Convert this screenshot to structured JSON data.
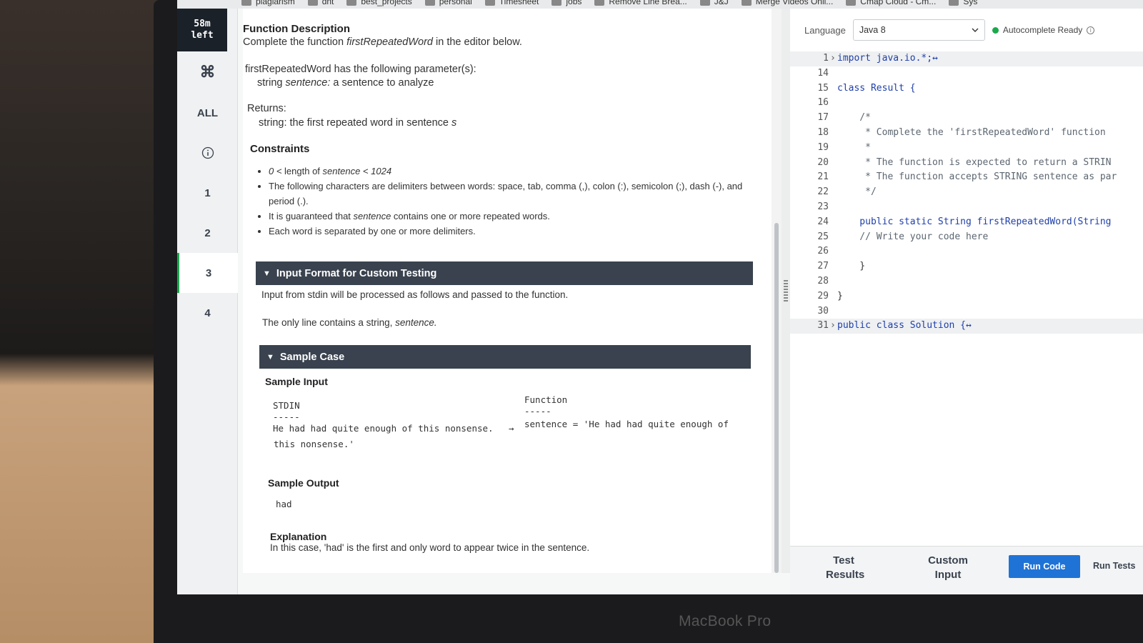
{
  "device_label": "MacBook Pro",
  "bookmarks": [
    "plagiarism",
    "dnt",
    "best_projects",
    "personal",
    "Timesheet",
    "jobs",
    "Remove Line Brea...",
    "J&J",
    "Merge Videos Onli...",
    "Cmap Cloud - Cm...",
    "Sys"
  ],
  "nav": {
    "timer": "58m left",
    "all": "ALL",
    "questions": [
      "1",
      "2",
      "3",
      "4"
    ],
    "active_question": "3"
  },
  "problem": {
    "function_description_title": "Function Description",
    "function_description_pre": "Complete the function ",
    "function_name": "firstRepeatedWord",
    "function_description_post": " in the editor below.",
    "params_title": "firstRepeatedWord has the following parameter(s):",
    "param_type": "string ",
    "param_name": "sentence:",
    "param_desc": " a sentence to analyze",
    "returns_title": "Returns:",
    "returns_desc": "string: the first repeated word in sentence ",
    "returns_var": "s",
    "constraints_title": "Constraints",
    "constraints": {
      "c1_pre": "0 < ",
      "c1_mid": "length of ",
      "c1_var": "sentence < 1024",
      "c2": "The following characters are delimiters between words: space, tab, comma (,), colon (:), semicolon (;), dash (-), and period (.).",
      "c3_pre": "It is guaranteed that ",
      "c3_var": "sentence",
      "c3_post": " contains one or more repeated words.",
      "c4": "Each word is separated by one or more delimiters."
    },
    "input_format_header": "Input Format for Custom Testing",
    "input_format_line1": "Input from stdin will be processed as follows and passed to the function.",
    "input_format_line2_pre": "The only line contains a string, ",
    "input_format_line2_var": "sentence.",
    "sample_case_header": "Sample Case",
    "sample_input_title": "Sample Input",
    "stdin_label": "STDIN",
    "function_label": "Function",
    "dashes": "-----",
    "stdin_value": "He had had quite enough of this nonsense.",
    "arrow": "→",
    "function_value": "sentence = 'He had had quite enough of",
    "function_value_cont": "this nonsense.'",
    "sample_output_title": "Sample Output",
    "sample_output": "had",
    "explanation_title": "Explanation",
    "explanation_text": "In this case, 'had' is the first and only word to appear twice in the sentence."
  },
  "editor": {
    "language_label": "Language",
    "language_value": "Java 8",
    "autocomplete_status": "Autocomplete Ready",
    "lines": [
      {
        "n": "1",
        "text": "import java.io.*;↔",
        "fold": true,
        "kind": "kw-import"
      },
      {
        "n": "14",
        "text": ""
      },
      {
        "n": "15",
        "text": "class Result {",
        "kind": "class"
      },
      {
        "n": "16",
        "text": ""
      },
      {
        "n": "17",
        "text": "    /*",
        "kind": "comment"
      },
      {
        "n": "18",
        "text": "     * Complete the 'firstRepeatedWord' function",
        "kind": "comment"
      },
      {
        "n": "19",
        "text": "     *",
        "kind": "comment"
      },
      {
        "n": "20",
        "text": "     * The function is expected to return a STRIN",
        "kind": "comment"
      },
      {
        "n": "21",
        "text": "     * The function accepts STRING sentence as par",
        "kind": "comment"
      },
      {
        "n": "22",
        "text": "     */",
        "kind": "comment"
      },
      {
        "n": "23",
        "text": ""
      },
      {
        "n": "24",
        "text": "    public static String firstRepeatedWord(String",
        "kind": "method"
      },
      {
        "n": "25",
        "text": "    // Write your code here",
        "kind": "comment"
      },
      {
        "n": "26",
        "text": ""
      },
      {
        "n": "27",
        "text": "    }"
      },
      {
        "n": "28",
        "text": ""
      },
      {
        "n": "29",
        "text": "}"
      },
      {
        "n": "30",
        "text": ""
      },
      {
        "n": "31",
        "text": "public class Solution {↔",
        "fold": true,
        "kind": "public-class"
      }
    ],
    "tabs": {
      "test_results": "Test Results",
      "custom_input": "Custom Input",
      "run_code": "Run Code",
      "run_tests": "Run Tests"
    }
  }
}
